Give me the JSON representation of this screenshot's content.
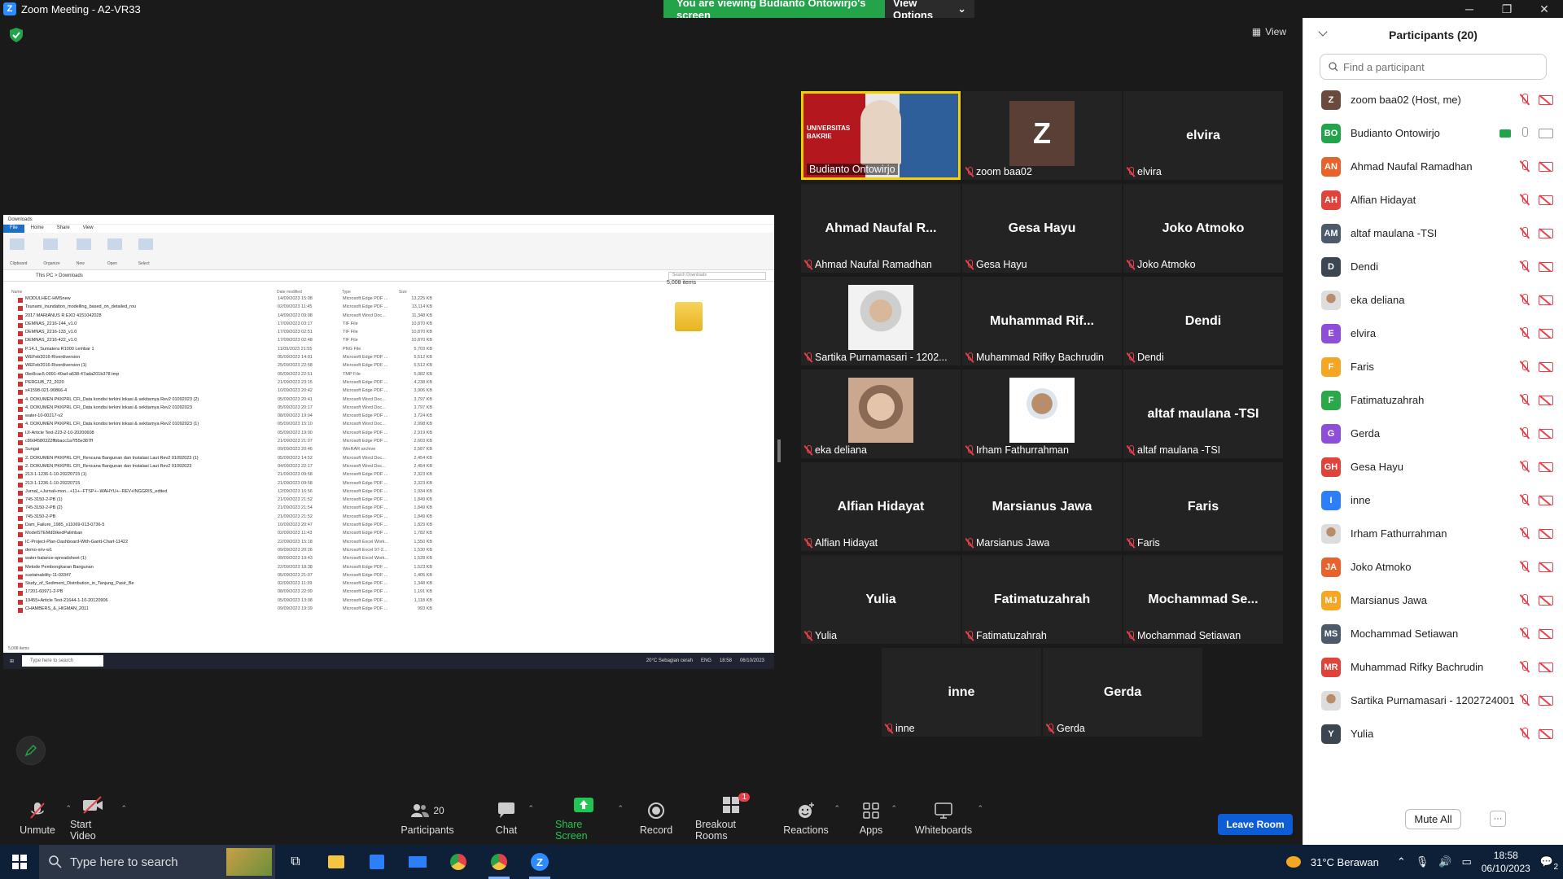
{
  "window": {
    "title": "Zoom Meeting - A2-VR33",
    "minimize": "─",
    "maximize": "❐",
    "close": "✕"
  },
  "share_banner": {
    "message": "You are viewing Budianto Ontowirjo's screen",
    "view_options": "View Options"
  },
  "view_button": "View",
  "shared_screen": {
    "title": "Downloads",
    "ribbon_tabs": [
      "File",
      "Home",
      "Share",
      "View"
    ],
    "ribbon_groups": [
      "Clipboard",
      "Organize",
      "New",
      "Open",
      "Select"
    ],
    "path": "This PC  >  Downloads",
    "search_placeholder": "Search Downloads",
    "columns": [
      "Name",
      "Date modified",
      "Type",
      "Size"
    ],
    "items_count": "5,008 items",
    "status": "5,008 items",
    "files": [
      {
        "name": "MODULHEC-HMSnew",
        "date": "14/09/2023 15:08",
        "type": "Microsoft Edge PDF ...",
        "size": "13,225 KB"
      },
      {
        "name": "Tsunami_inundation_modelling_based_on_detailed_rou",
        "date": "02/09/2023 11:45",
        "type": "Microsoft Edge PDF ...",
        "size": "13,114 KB"
      },
      {
        "name": "2017 MARIANUS R EXO 4151042028",
        "date": "14/09/2023 09:08",
        "type": "Microsoft Word Doc...",
        "size": "11,348 KB"
      },
      {
        "name": "DEMNAS_2216-144_v1.0",
        "date": "17/09/2023 03:17",
        "type": "TIF File",
        "size": "10,870 KB"
      },
      {
        "name": "DEMNAS_2216-133_v1.0",
        "date": "17/09/2023 02:51",
        "type": "TIF File",
        "size": "10,870 KB"
      },
      {
        "name": "DEMNAS_2216-422_v1.0",
        "date": "17/09/2023 02:48",
        "type": "TIF File",
        "size": "10,870 KB"
      },
      {
        "name": "P.14.1_Sumatera R1000 Lembar 1",
        "date": "11/09/2023 21:55",
        "type": "PNG File",
        "size": "5,703 KB"
      },
      {
        "name": "WEFeb2016-Riverdiversion",
        "date": "05/09/2023 14:01",
        "type": "Microsoft Edge PDF ...",
        "size": "5,512 KB"
      },
      {
        "name": "WEFeb2016-Riverdiversion (1)",
        "date": "25/09/2023 22:58",
        "type": "Microsoft Edge PDF ...",
        "size": "5,512 KB"
      },
      {
        "name": "0be8cac5-0091-40ad-a638-47ada201b378.tmp",
        "date": "05/09/2023 22:51",
        "type": "TMP File",
        "size": "5,082 KB"
      },
      {
        "name": "PERGUB_72_2020",
        "date": "21/09/2023 23:15",
        "type": "Microsoft Edge PDF ...",
        "size": "4,238 KB"
      },
      {
        "name": "s41598-021-90866-4",
        "date": "10/09/2023 20:42",
        "type": "Microsoft Edge PDF ...",
        "size": "3,906 KB"
      },
      {
        "name": "4. DOKUMEN PKKPRL CFI_Data kondisi terkini lokasi & sekitarnya Rev2 01092023 (2)",
        "date": "05/09/2023 20:41",
        "type": "Microsoft Word Doc...",
        "size": "3,797 KB"
      },
      {
        "name": "4. DOKUMEN PKKPRL CFI_Data kondisi terkini lokasi & sekitarnya Rev2 01092023",
        "date": "05/09/2023 20:17",
        "type": "Microsoft Word Doc...",
        "size": "3,797 KB"
      },
      {
        "name": "water-10-00217-v2",
        "date": "08/09/2023 19:04",
        "type": "Microsoft Edge PDF ...",
        "size": "3,724 KB"
      },
      {
        "name": "4. DOKUMEN PKKPRL CFI_Data kondisi terkini lokasi & sekitarnya Rev2 01092023 (1)",
        "date": "05/09/2023 15:10",
        "type": "Microsoft Word Doc...",
        "size": "2,998 KB"
      },
      {
        "name": "IJI-Article Text-223-2-10-20200608",
        "date": "05/09/2023 19:00",
        "type": "Microsoft Edge PDF ...",
        "size": "2,919 KB"
      },
      {
        "name": "c89d4580322ffbbacc1a7f55e387ff",
        "date": "21/09/2023 21:07",
        "type": "Microsoft Edge PDF ...",
        "size": "2,603 KB"
      },
      {
        "name": "Sungai",
        "date": "09/09/2023 20:46",
        "type": "WinRAR archive",
        "size": "2,587 KB"
      },
      {
        "name": "2. DOKUMEN PKKPRL CFI_Rencana Bangunan dan Instalasi Laut Rev2 01092023 (1)",
        "date": "05/09/2023 14:52",
        "type": "Microsoft Word Doc...",
        "size": "2,454 KB"
      },
      {
        "name": "2. DOKUMEN PKKPRL CFI_Rencana Bangunan dan Instalasi Laut Rev2 01092023",
        "date": "04/09/2023 22:17",
        "type": "Microsoft Word Doc...",
        "size": "2,454 KB"
      },
      {
        "name": "213-1-1236-1-10-20220715 (1)",
        "date": "21/09/2023 09:58",
        "type": "Microsoft Edge PDF ...",
        "size": "2,323 KB"
      },
      {
        "name": "213-1-1236-1-10-20220715",
        "date": "21/09/2023 09:58",
        "type": "Microsoft Edge PDF ...",
        "size": "2,323 KB"
      },
      {
        "name": "Jurnal_+Jurnal+mon...+11+--FTSP+--WAHYU+--REV+INGGRIS_edited",
        "date": "12/09/2023 16:56",
        "type": "Microsoft Edge PDF ...",
        "size": "1,934 KB"
      },
      {
        "name": "745-3150-2-PB (1)",
        "date": "21/09/2023 21:52",
        "type": "Microsoft Edge PDF ...",
        "size": "1,849 KB"
      },
      {
        "name": "745-3150-2-PB (2)",
        "date": "21/09/2023 21:54",
        "type": "Microsoft Edge PDF ...",
        "size": "1,849 KB"
      },
      {
        "name": "745-3150-2-PB",
        "date": "21/09/2023 21:52",
        "type": "Microsoft Edge PDF ...",
        "size": "1,849 KB"
      },
      {
        "name": "Dam_Failure_1985_s11069-013-0736-5",
        "date": "10/09/2023 20:47",
        "type": "Microsoft Edge PDF ...",
        "size": "1,829 KB"
      },
      {
        "name": "ModelSTEMdDikedPalimban",
        "date": "02/09/2023 11:43",
        "type": "Microsoft Edge PDF ...",
        "size": "1,782 KB"
      },
      {
        "name": "IC-Project-Plan-Dashboard-With-Gantt-Chart-11422",
        "date": "22/09/2023 15:18",
        "type": "Microsoft Excel Work...",
        "size": "1,550 KB"
      },
      {
        "name": "demo-xnv-w1",
        "date": "09/09/2023 20:26",
        "type": "Microsoft Excel 97-2...",
        "size": "1,530 KB"
      },
      {
        "name": "water-balance-spreadsheet (1)",
        "date": "09/09/2023 19:43",
        "type": "Microsoft Excel Work...",
        "size": "1,528 KB"
      },
      {
        "name": "Metode Pembongkaran Bangunan",
        "date": "22/09/2023 18:38",
        "type": "Microsoft Edge PDF ...",
        "size": "1,523 KB"
      },
      {
        "name": "sustainability-11-03347",
        "date": "05/09/2023 21:07",
        "type": "Microsoft Edge PDF ...",
        "size": "1,405 KB"
      },
      {
        "name": "Study_of_Sediment_Distribution_in_Tanjung_Pasir_Be",
        "date": "02/09/2023 11:39",
        "type": "Microsoft Edge PDF ...",
        "size": "1,348 KB"
      },
      {
        "name": "17201-60971-2-PB",
        "date": "08/09/2023 22:09",
        "type": "Microsoft Edge PDF ...",
        "size": "1,191 KB"
      },
      {
        "name": "19455+Article Text-21644-1-10-20120906",
        "date": "05/09/2023 13:08",
        "type": "Microsoft Edge PDF ...",
        "size": "1,118 KB"
      },
      {
        "name": "CHAMBERS_&_HIGMAN_2011",
        "date": "09/09/2023 19:39",
        "type": "Microsoft Edge PDF ...",
        "size": "993 KB"
      }
    ],
    "mini_taskbar": {
      "search": "Type here to search",
      "weather": "20°C  Sebagian cerah",
      "lang": "ENG",
      "time": "18:58",
      "date": "06/10/2023"
    }
  },
  "tiles": [
    {
      "display": "",
      "label": "Budianto Ontowirjo",
      "muted": false,
      "kind": "video"
    },
    {
      "display": "Z",
      "label": "zoom baa02",
      "muted": true,
      "kind": "avatar"
    },
    {
      "display": "elvira",
      "label": "elvira",
      "muted": true,
      "kind": "name"
    },
    {
      "display": "Ahmad Naufal R...",
      "label": "Ahmad Naufal Ramadhan",
      "muted": true,
      "kind": "name"
    },
    {
      "display": "Gesa Hayu",
      "label": "Gesa Hayu",
      "muted": true,
      "kind": "name"
    },
    {
      "display": "Joko Atmoko",
      "label": "Joko Atmoko",
      "muted": true,
      "kind": "name"
    },
    {
      "display": "",
      "label": "Sartika Purnamasari - 1202...",
      "muted": true,
      "kind": "photo"
    },
    {
      "display": "Muhammad  Rif...",
      "label": "Muhammad Rifky Bachrudin",
      "muted": true,
      "kind": "name"
    },
    {
      "display": "Dendi",
      "label": "Dendi",
      "muted": true,
      "kind": "name"
    },
    {
      "display": "",
      "label": "eka deliana",
      "muted": true,
      "kind": "photo"
    },
    {
      "display": "",
      "label": "Irham Fathurrahman",
      "muted": true,
      "kind": "photo"
    },
    {
      "display": "altaf maulana -TSI",
      "label": "altaf maulana -TSI",
      "muted": true,
      "kind": "name"
    },
    {
      "display": "Alfian Hidayat",
      "label": "Alfian Hidayat",
      "muted": true,
      "kind": "name"
    },
    {
      "display": "Marsianus Jawa",
      "label": "Marsianus Jawa",
      "muted": true,
      "kind": "name"
    },
    {
      "display": "Faris",
      "label": "Faris",
      "muted": true,
      "kind": "name"
    },
    {
      "display": "Yulia",
      "label": "Yulia",
      "muted": true,
      "kind": "name"
    },
    {
      "display": "Fatimatuzahrah",
      "label": "Fatimatuzahrah",
      "muted": true,
      "kind": "name"
    },
    {
      "display": "Mochammad  Se...",
      "label": "Mochammad Setiawan",
      "muted": true,
      "kind": "name"
    },
    {
      "display": "inne",
      "label": "inne",
      "muted": true,
      "kind": "name"
    },
    {
      "display": "Gerda",
      "label": "Gerda",
      "muted": true,
      "kind": "name"
    }
  ],
  "presenter_overlay": "UNIVERSITAS BAKRIE",
  "participants": {
    "title": "Participants (20)",
    "find_placeholder": "Find a participant",
    "mute_all": "Mute All",
    "more": "···",
    "list": [
      {
        "initials": "Z",
        "name": "zoom baa02 (Host, me)",
        "color": "#6b4a3e",
        "sharing": false
      },
      {
        "initials": "BO",
        "name": "Budianto Ontowirjo",
        "color": "#23a34a",
        "sharing": true
      },
      {
        "initials": "AN",
        "name": "Ahmad Naufal Ramadhan",
        "color": "#e8622c",
        "sharing": false
      },
      {
        "initials": "AH",
        "name": "Alfian Hidayat",
        "color": "#e0433a",
        "sharing": false
      },
      {
        "initials": "AM",
        "name": "altaf maulana -TSI",
        "color": "#4c5a6a",
        "sharing": false
      },
      {
        "initials": "D",
        "name": "Dendi",
        "color": "#3c4650",
        "sharing": false
      },
      {
        "initials": "",
        "name": "eka deliana",
        "color": "#c9a58c",
        "sharing": false
      },
      {
        "initials": "E",
        "name": "elvira",
        "color": "#8d4fd8",
        "sharing": false
      },
      {
        "initials": "F",
        "name": "Faris",
        "color": "#f5a623",
        "sharing": false
      },
      {
        "initials": "F",
        "name": "Fatimatuzahrah",
        "color": "#2aa84a",
        "sharing": false
      },
      {
        "initials": "G",
        "name": "Gerda",
        "color": "#8d4fd8",
        "sharing": false
      },
      {
        "initials": "GH",
        "name": "Gesa Hayu",
        "color": "#e0433a",
        "sharing": false
      },
      {
        "initials": "I",
        "name": "inne",
        "color": "#2d7ff9",
        "sharing": false
      },
      {
        "initials": "",
        "name": "Irham Fathurrahman",
        "color": "#ffffff",
        "sharing": false
      },
      {
        "initials": "JA",
        "name": "Joko Atmoko",
        "color": "#e8622c",
        "sharing": false
      },
      {
        "initials": "MJ",
        "name": "Marsianus Jawa",
        "color": "#f5a623",
        "sharing": false
      },
      {
        "initials": "MS",
        "name": "Mochammad Setiawan",
        "color": "#4c5a6a",
        "sharing": false
      },
      {
        "initials": "MR",
        "name": "Muhammad Rifky Bachrudin",
        "color": "#e0433a",
        "sharing": false
      },
      {
        "initials": "",
        "name": "Sartika Purnamasari - 1202724001",
        "color": "#ffffff",
        "sharing": false
      },
      {
        "initials": "Y",
        "name": "Yulia",
        "color": "#3c4650",
        "sharing": false
      }
    ]
  },
  "toolbar": {
    "unmute": "Unmute",
    "start_video": "Start Video",
    "participants": "Participants",
    "participants_count": "20",
    "chat": "Chat",
    "share_screen": "Share Screen",
    "record": "Record",
    "breakout_rooms": "Breakout Rooms",
    "breakout_badge": "1",
    "reactions": "Reactions",
    "apps": "Apps",
    "whiteboards": "Whiteboards",
    "leave_room": "Leave Room"
  },
  "taskbar": {
    "search": "Type here to search",
    "weather": "31°C  Berawan",
    "time": "18:58",
    "date": "06/10/2023",
    "notif": "2"
  },
  "colors": {
    "accent": "#2d8cff",
    "share_green": "#23a34a",
    "muted_red": "#e8404a",
    "active_speaker": "#f5d000",
    "leave_blue": "#0e5cd6"
  }
}
